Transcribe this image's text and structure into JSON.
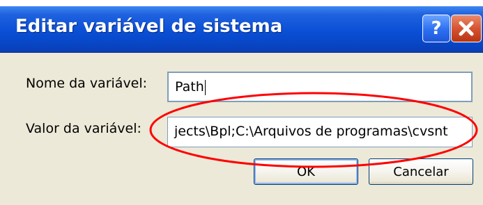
{
  "window": {
    "title": "Editar variável de sistema",
    "help_label": "?",
    "close_label": "Close"
  },
  "form": {
    "name_label": "Nome da variável:",
    "name_value": "Path",
    "value_label": "Valor da variável:",
    "value_value": "jects\\Bpl;C:\\Arquivos de programas\\cvsnt"
  },
  "buttons": {
    "ok_label": "OK",
    "cancel_label": "Cancelar"
  },
  "colors": {
    "titlebar": "#0a4fd6",
    "dialog_bg": "#ece9d8",
    "annotation": "#ff0000"
  }
}
